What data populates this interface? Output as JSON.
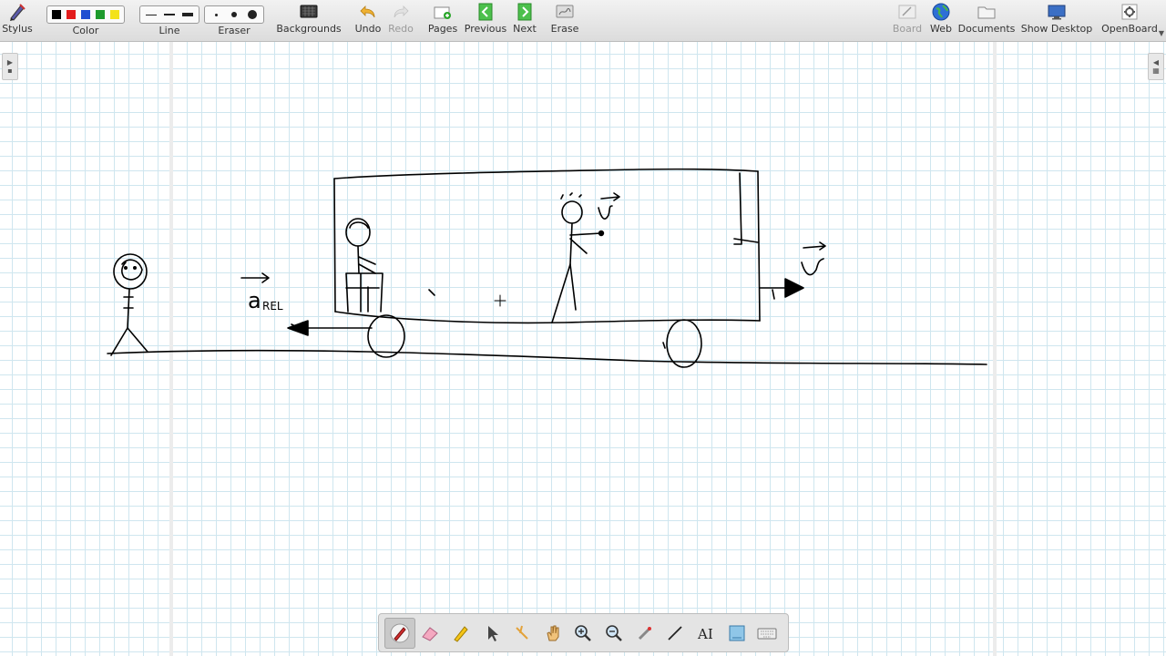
{
  "toolbar": {
    "stylus": "Stylus",
    "color": "Color",
    "line": "Line",
    "eraser": "Eraser",
    "backgrounds": "Backgrounds",
    "undo": "Undo",
    "redo": "Redo",
    "pages": "Pages",
    "previous": "Previous",
    "next": "Next",
    "erase": "Erase",
    "board": "Board",
    "web": "Web",
    "documents": "Documents",
    "show_desktop": "Show Desktop",
    "openboard": "OpenBoard"
  },
  "colors": {
    "swatches": [
      "#000000",
      "#e31b1b",
      "#1f4fd1",
      "#1d9a2c",
      "#f3e219"
    ],
    "grid": "#cfe6ef",
    "ink": "#000000"
  },
  "board": {
    "annotation_a": "a",
    "annotation_a_sub": "REL",
    "annotation_v_inside": "v",
    "annotation_v_outside": "v"
  },
  "palette": {
    "tools": [
      "pen-icon",
      "eraser-icon",
      "marker-icon",
      "selector-icon",
      "play-icon",
      "hand-icon",
      "zoom-in-icon",
      "zoom-out-icon",
      "laser-pointer-icon",
      "line-icon",
      "text-icon",
      "capture-icon",
      "keyboard-icon"
    ]
  }
}
